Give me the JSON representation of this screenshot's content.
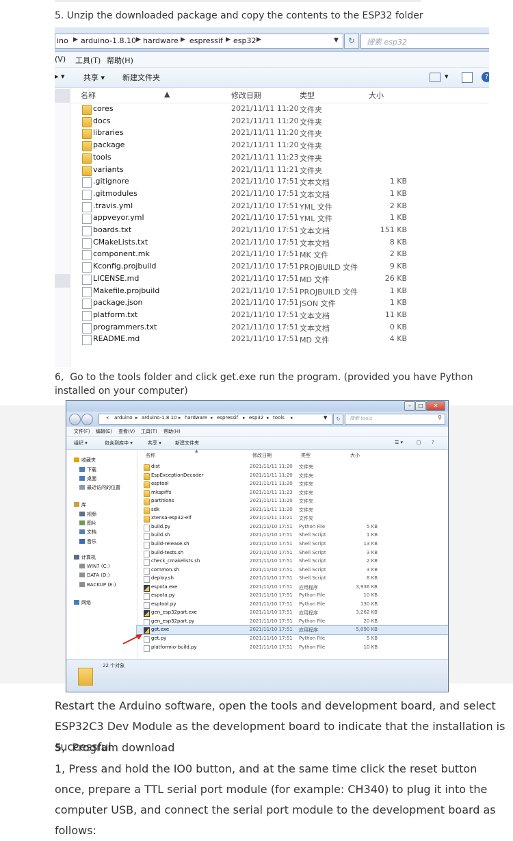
{
  "step5_heading": "5. Unzip the downloaded package and copy the contents to the ESP32 folder",
  "explorer1": {
    "breadcrumb": [
      "ino",
      "arduino-1.8.10",
      "hardware",
      "espressif",
      "esp32"
    ],
    "search_placeholder": "搜索 esp32",
    "refresh_icon": "refresh-icon",
    "menu": [
      "(V)",
      "工具(T)",
      "帮助(H)"
    ],
    "toolbar": [
      "共享 ▾",
      "新建文件夹"
    ],
    "columns": {
      "name": "名称",
      "date": "修改日期",
      "type": "类型",
      "size": "大小"
    },
    "rows": [
      {
        "name": "cores",
        "date": "2021/11/11 11:20",
        "type": "文件夹",
        "size": "",
        "icon": "folder"
      },
      {
        "name": "docs",
        "date": "2021/11/11 11:20",
        "type": "文件夹",
        "size": "",
        "icon": "folder"
      },
      {
        "name": "libraries",
        "date": "2021/11/11 11:20",
        "type": "文件夹",
        "size": "",
        "icon": "folder"
      },
      {
        "name": "package",
        "date": "2021/11/11 11:20",
        "type": "文件夹",
        "size": "",
        "icon": "folder"
      },
      {
        "name": "tools",
        "date": "2021/11/11 11:23",
        "type": "文件夹",
        "size": "",
        "icon": "folder"
      },
      {
        "name": "variants",
        "date": "2021/11/11 11:21",
        "type": "文件夹",
        "size": "",
        "icon": "folder"
      },
      {
        "name": ".gitignore",
        "date": "2021/11/10 17:51",
        "type": "文本文档",
        "size": "1 KB",
        "icon": "file"
      },
      {
        "name": ".gitmodules",
        "date": "2021/11/10 17:51",
        "type": "文本文档",
        "size": "1 KB",
        "icon": "file"
      },
      {
        "name": ".travis.yml",
        "date": "2021/11/10 17:51",
        "type": "YML 文件",
        "size": "2 KB",
        "icon": "file"
      },
      {
        "name": "appveyor.yml",
        "date": "2021/11/10 17:51",
        "type": "YML 文件",
        "size": "1 KB",
        "icon": "file"
      },
      {
        "name": "boards.txt",
        "date": "2021/11/10 17:51",
        "type": "文本文档",
        "size": "151 KB",
        "icon": "file"
      },
      {
        "name": "CMakeLists.txt",
        "date": "2021/11/10 17:51",
        "type": "文本文档",
        "size": "8 KB",
        "icon": "file"
      },
      {
        "name": "component.mk",
        "date": "2021/11/10 17:51",
        "type": "MK 文件",
        "size": "2 KB",
        "icon": "file"
      },
      {
        "name": "Kconfig.projbuild",
        "date": "2021/11/10 17:51",
        "type": "PROJBUILD 文件",
        "size": "9 KB",
        "icon": "file"
      },
      {
        "name": "LICENSE.md",
        "date": "2021/11/10 17:51",
        "type": "MD 文件",
        "size": "26 KB",
        "icon": "file"
      },
      {
        "name": "Makefile.projbuild",
        "date": "2021/11/10 17:51",
        "type": "PROJBUILD 文件",
        "size": "1 KB",
        "icon": "file"
      },
      {
        "name": "package.json",
        "date": "2021/11/10 17:51",
        "type": "JSON 文件",
        "size": "1 KB",
        "icon": "file"
      },
      {
        "name": "platform.txt",
        "date": "2021/11/10 17:51",
        "type": "文本文档",
        "size": "11 KB",
        "icon": "file"
      },
      {
        "name": "programmers.txt",
        "date": "2021/11/10 17:51",
        "type": "文本文档",
        "size": "0 KB",
        "icon": "file"
      },
      {
        "name": "README.md",
        "date": "2021/11/10 17:51",
        "type": "MD 文件",
        "size": "4 KB",
        "icon": "file"
      }
    ]
  },
  "step6_heading": "6,  Go to the tools folder and click get.exe run the program. (provided you have Python installed on your computer)",
  "explorer2": {
    "breadcrumb": [
      "«",
      "arduino",
      "arduino-1.8.10",
      "hardware",
      "espressif",
      "esp32",
      "tools"
    ],
    "search_placeholder": "搜索 tools",
    "menu": [
      "文件(F)",
      "编辑(E)",
      "查看(V)",
      "工具(T)",
      "帮助(H)"
    ],
    "toolbar": [
      "组织 ▾",
      "包含到库中 ▾",
      "共享 ▾",
      "新建文件夹"
    ],
    "columns": {
      "name": "名称",
      "date": "修改日期",
      "type": "类型",
      "size": "大小"
    },
    "sidebar": [
      {
        "label": "收藏夹",
        "icon": "star"
      },
      {
        "label": "下载",
        "icon": "download"
      },
      {
        "label": "桌面",
        "icon": "desktop"
      },
      {
        "label": "最近访问的位置",
        "icon": "recent"
      },
      {
        "label": "库",
        "icon": "library"
      },
      {
        "label": "视频",
        "icon": "video"
      },
      {
        "label": "图片",
        "icon": "picture"
      },
      {
        "label": "文档",
        "icon": "document"
      },
      {
        "label": "音乐",
        "icon": "music"
      },
      {
        "label": "计算机",
        "icon": "computer"
      },
      {
        "label": "WIN7 (C:)",
        "icon": "drive"
      },
      {
        "label": "DATA (D:)",
        "icon": "drive"
      },
      {
        "label": "BACKUP (E:)",
        "icon": "drive"
      },
      {
        "label": "网络",
        "icon": "network"
      }
    ],
    "rows": [
      {
        "name": "dist",
        "date": "2021/11/11 11:20",
        "type": "文件夹",
        "size": "",
        "icon": "folder"
      },
      {
        "name": "EspExceptionDecoder",
        "date": "2021/11/11 11:20",
        "type": "文件夹",
        "size": "",
        "icon": "folder"
      },
      {
        "name": "esptool",
        "date": "2021/11/11 11:20",
        "type": "文件夹",
        "size": "",
        "icon": "folder"
      },
      {
        "name": "mkspiffs",
        "date": "2021/11/11 11:23",
        "type": "文件夹",
        "size": "",
        "icon": "folder"
      },
      {
        "name": "partitions",
        "date": "2021/11/11 11:20",
        "type": "文件夹",
        "size": "",
        "icon": "folder"
      },
      {
        "name": "sdk",
        "date": "2021/11/11 11:20",
        "type": "文件夹",
        "size": "",
        "icon": "folder"
      },
      {
        "name": "xtensa-esp32-elf",
        "date": "2021/11/11 11:21",
        "type": "文件夹",
        "size": "",
        "icon": "folder"
      },
      {
        "name": "build.py",
        "date": "2021/11/10 17:51",
        "type": "Python File",
        "size": "5 KB",
        "icon": "file"
      },
      {
        "name": "build.sh",
        "date": "2021/11/10 17:51",
        "type": "Shell Script",
        "size": "1 KB",
        "icon": "file"
      },
      {
        "name": "build-release.sh",
        "date": "2021/11/10 17:51",
        "type": "Shell Script",
        "size": "13 KB",
        "icon": "file"
      },
      {
        "name": "build-tests.sh",
        "date": "2021/11/10 17:51",
        "type": "Shell Script",
        "size": "3 KB",
        "icon": "file"
      },
      {
        "name": "check_cmakelists.sh",
        "date": "2021/11/10 17:51",
        "type": "Shell Script",
        "size": "2 KB",
        "icon": "file"
      },
      {
        "name": "common.sh",
        "date": "2021/11/10 17:51",
        "type": "Shell Script",
        "size": "3 KB",
        "icon": "file"
      },
      {
        "name": "deploy.sh",
        "date": "2021/11/10 17:51",
        "type": "Shell Script",
        "size": "8 KB",
        "icon": "file"
      },
      {
        "name": "espota.exe",
        "date": "2021/11/10 17:51",
        "type": "应用程序",
        "size": "3,936 KB",
        "icon": "exe"
      },
      {
        "name": "espota.py",
        "date": "2021/11/10 17:51",
        "type": "Python File",
        "size": "10 KB",
        "icon": "file"
      },
      {
        "name": "esptool.py",
        "date": "2021/11/10 17:51",
        "type": "Python File",
        "size": "130 KB",
        "icon": "file"
      },
      {
        "name": "gen_esp32part.exe",
        "date": "2021/11/10 17:51",
        "type": "应用程序",
        "size": "3,262 KB",
        "icon": "exe"
      },
      {
        "name": "gen_esp32part.py",
        "date": "2021/11/10 17:51",
        "type": "Python File",
        "size": "20 KB",
        "icon": "file"
      },
      {
        "name": "get.exe",
        "date": "2021/11/10 17:51",
        "type": "应用程序",
        "size": "5,090 KB",
        "icon": "exe",
        "selected": true
      },
      {
        "name": "get.py",
        "date": "2021/11/10 17:51",
        "type": "Python File",
        "size": "5 KB",
        "icon": "file"
      },
      {
        "name": "platformio-build.py",
        "date": "2021/11/10 17:51",
        "type": "Python File",
        "size": "10 KB",
        "icon": "file"
      }
    ],
    "status": "22 个对象",
    "arrow_color": "#d9261c"
  },
  "restart_text": "Restart the Arduino software, open the tools and development board, and select ESP32C3 Dev Module as the development board to indicate that the installation is successful.",
  "step_program_download": "5,  Program download",
  "instructions": "1, Press and hold the IO0 button, and at the same time click the reset button once, prepare a TTL serial port module (for example: CH340) to plug it into the computer USB, and connect the serial port module to the development board as follows:"
}
